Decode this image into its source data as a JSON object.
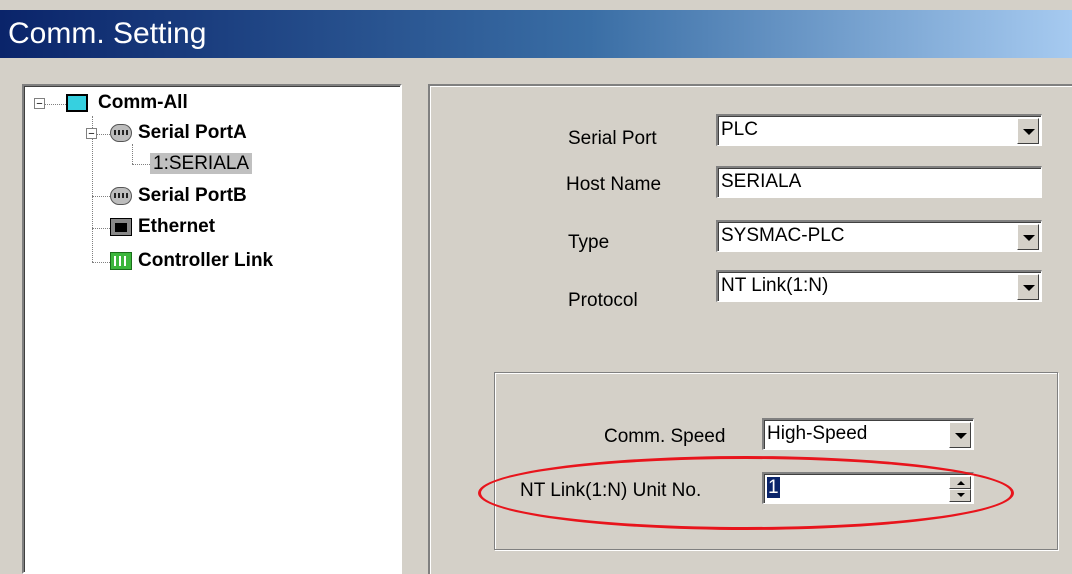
{
  "window": {
    "title": "Comm. Setting"
  },
  "tree": {
    "items": [
      {
        "label": "Comm-All",
        "icon": "monitor-icon"
      },
      {
        "label": "Serial PortA",
        "icon": "serial-port-icon"
      },
      {
        "label": "1:SERIALA"
      },
      {
        "label": "Serial PortB",
        "icon": "serial-port-icon"
      },
      {
        "label": "Ethernet",
        "icon": "ethernet-icon"
      },
      {
        "label": "Controller Link",
        "icon": "controller-link-icon"
      }
    ]
  },
  "form": {
    "serial_port": {
      "label": "Serial Port",
      "value": "PLC"
    },
    "host_name": {
      "label": "Host Name",
      "value": "SERIALA"
    },
    "type": {
      "label": "Type",
      "value": "SYSMAC-PLC"
    },
    "protocol": {
      "label": "Protocol",
      "value": "NT Link(1:N)"
    },
    "comm_speed": {
      "label": "Comm. Speed",
      "value": "High-Speed"
    },
    "unit_no": {
      "label": "NT Link(1:N) Unit No.",
      "value": "1"
    }
  },
  "colors": {
    "highlight_ellipse": "#e8141c",
    "title_gradient_start": "#0a246a",
    "title_gradient_end": "#a6caf0"
  }
}
